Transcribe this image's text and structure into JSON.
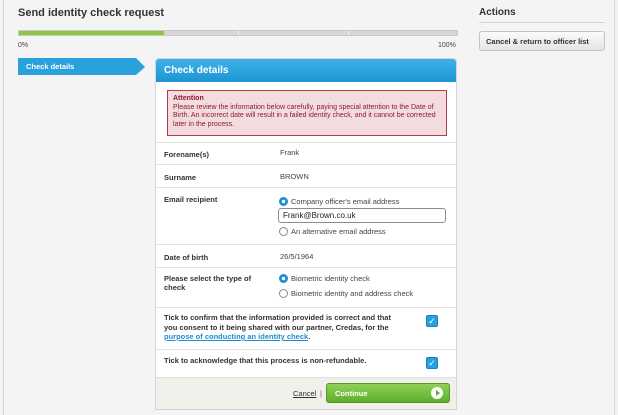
{
  "page": {
    "title": "Send identity check request"
  },
  "progress": {
    "value_percent": 33,
    "start_label": "0%",
    "end_label": "100%"
  },
  "steps": {
    "current": "Check details"
  },
  "card": {
    "title": "Check details",
    "attention": {
      "title": "Attention",
      "text": "Please review the information below carefully, paying special attention to the Date of Birth. An incorrect date will result in a failed identity check, and it cannot be corrected later in the process."
    },
    "forename": {
      "label": "Forename(s)",
      "value": "Frank"
    },
    "surname": {
      "label": "Surname",
      "value": "BROWN"
    },
    "email": {
      "label": "Email recipient",
      "option_company": "Company officer's email address",
      "input_value": "Frank@Brown.co.uk",
      "option_alternative": "An alternative email address"
    },
    "dob": {
      "label": "Date of birth",
      "value": "26/5/1964"
    },
    "check_type": {
      "label": "Please select the type of check",
      "option_biometric": "Biometric identity check",
      "option_biometric_address": "Biometric identity and address check"
    },
    "confirm": {
      "text_before": "Tick to confirm that the information provided is correct and that you consent to it being shared with our partner, Credas, for the ",
      "link": "purpose of conducting an identity check",
      "text_after": "."
    },
    "non_refundable": {
      "text": "Tick to acknowledge that this process is non-refundable."
    },
    "footer": {
      "cancel_label": "Cancel",
      "separator": "|",
      "continue_label": "Continue"
    }
  },
  "actions": {
    "title": "Actions",
    "cancel_return_label": "Cancel & return to officer list"
  },
  "colors": {
    "accent_blue": "#29a1dc",
    "progress_green": "#8dc63f",
    "attention_red": "#b13a4b",
    "continue_green": "#5fae2b"
  }
}
